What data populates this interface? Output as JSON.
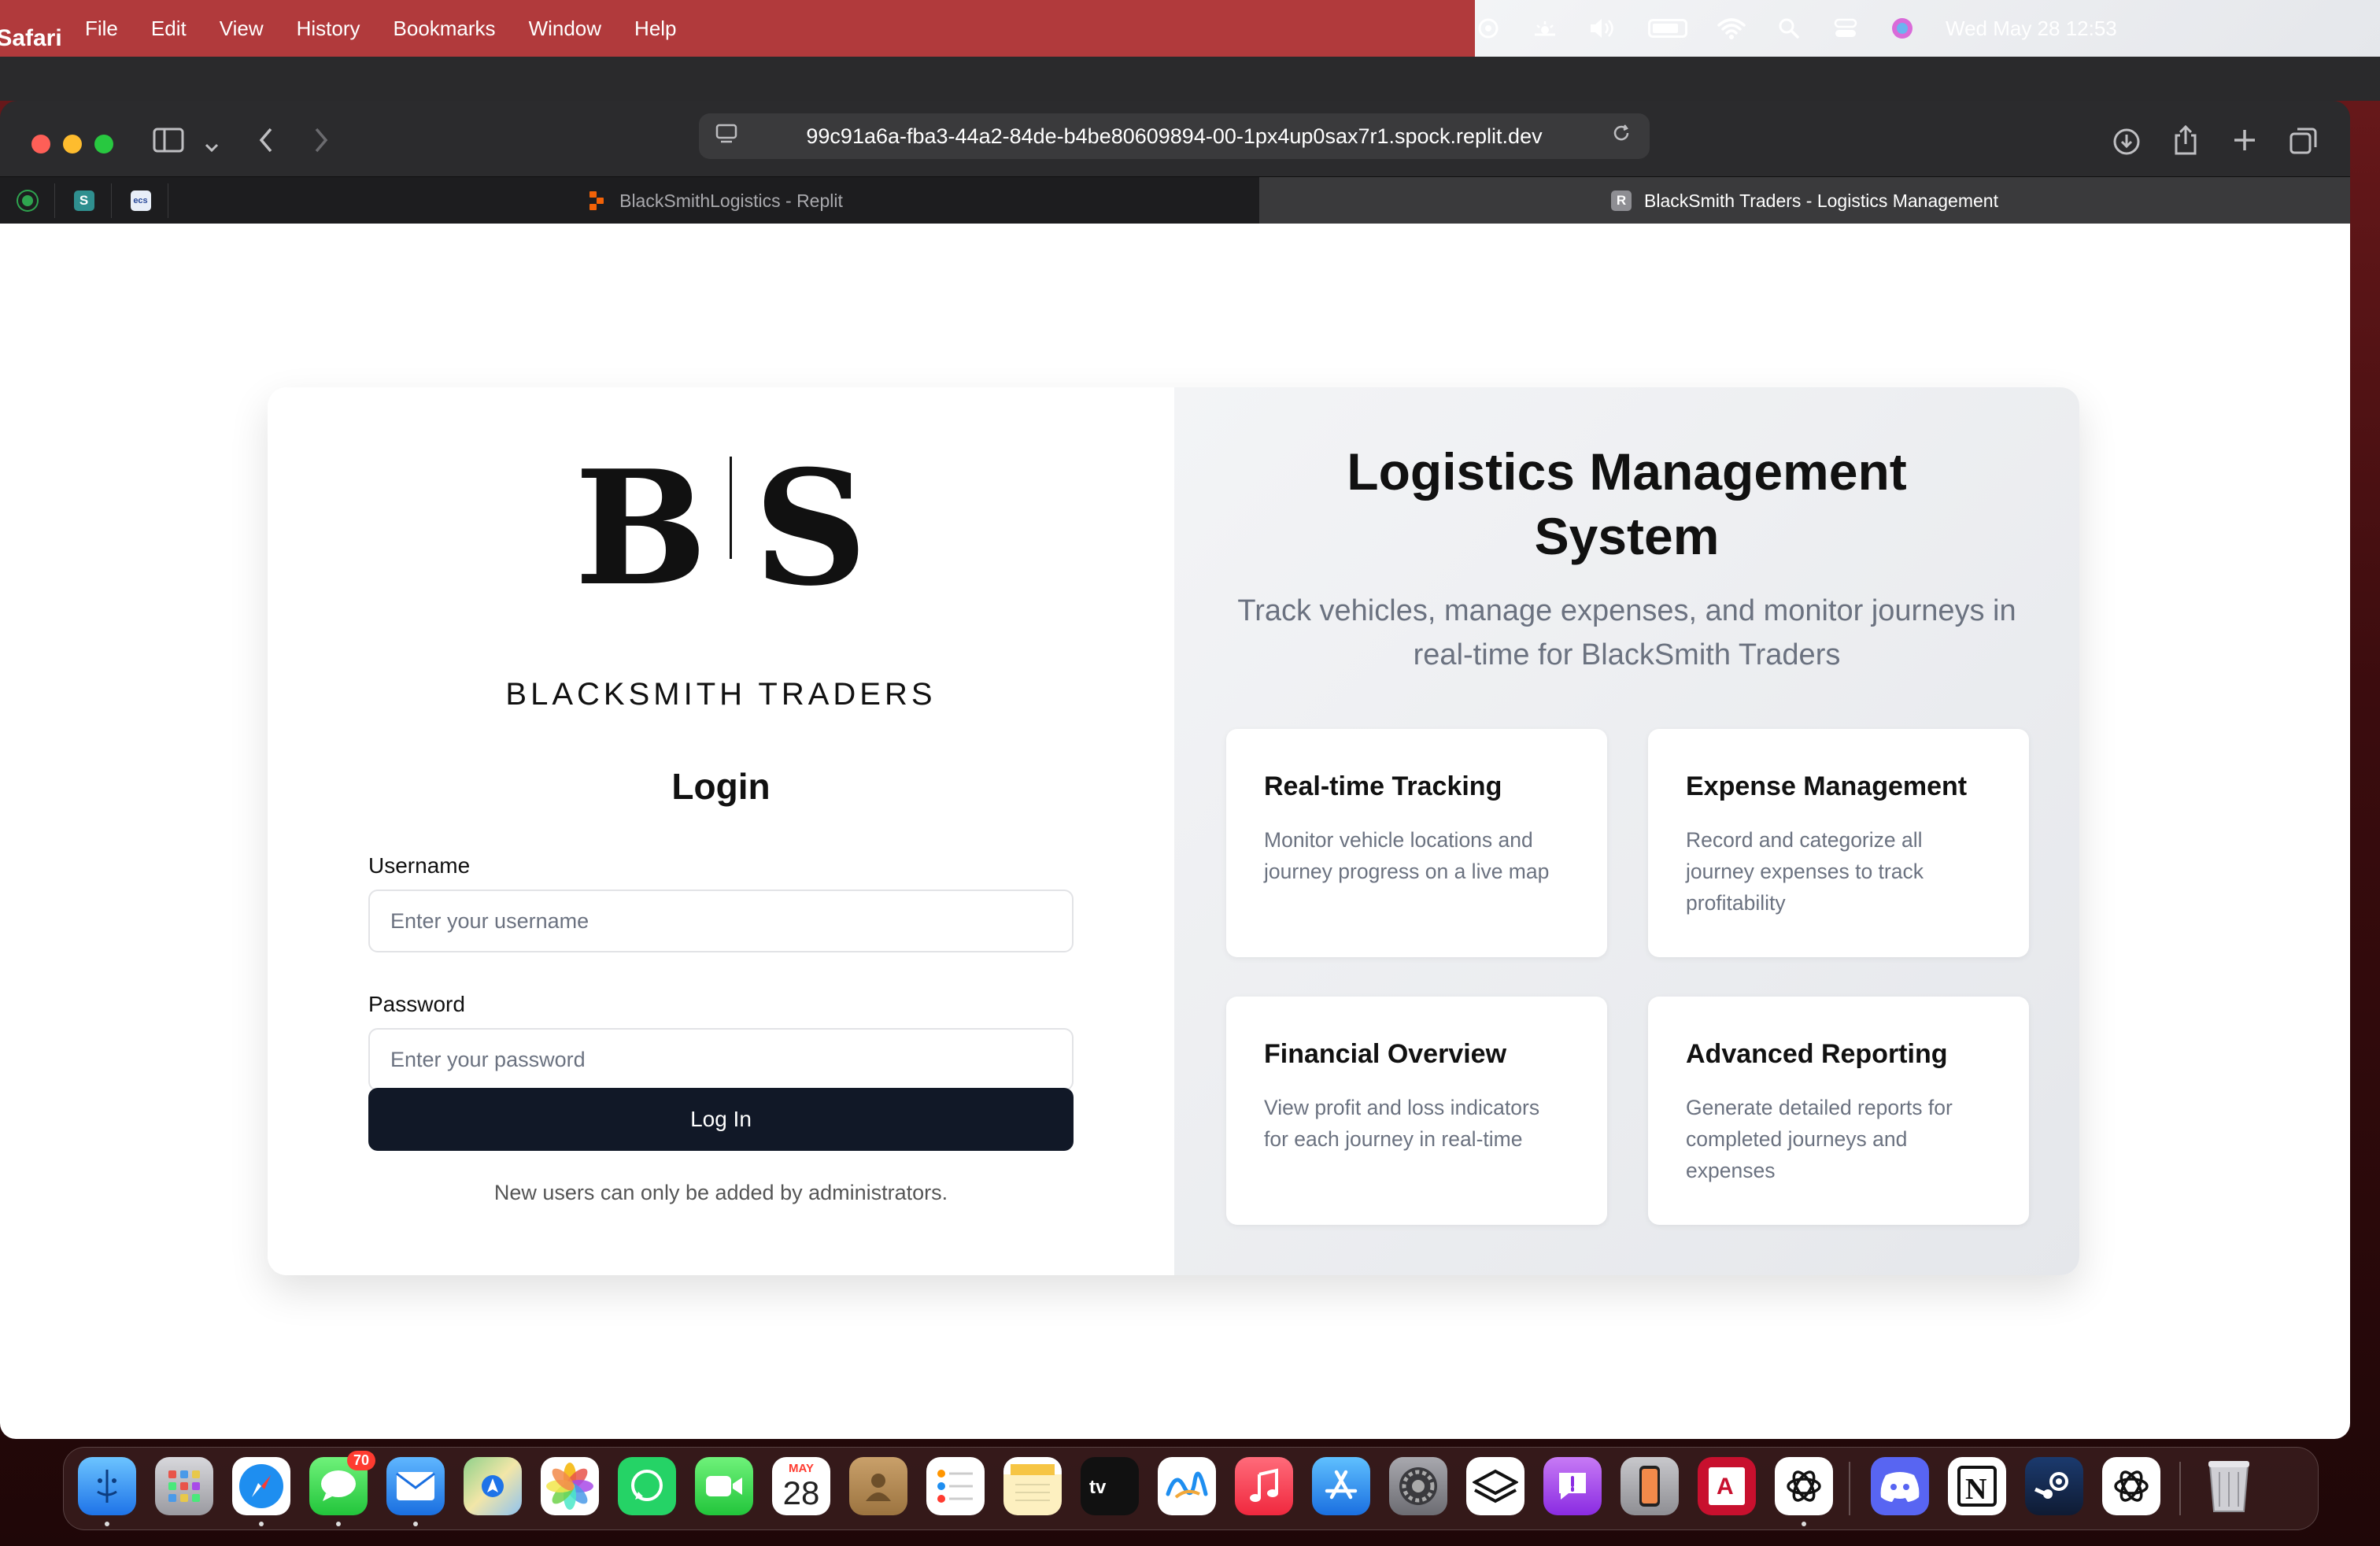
{
  "menubar": {
    "app_name": "Safari",
    "items": [
      "File",
      "Edit",
      "View",
      "History",
      "Bookmarks",
      "Window",
      "Help"
    ],
    "clock": "Wed May 28  12:53",
    "battery_level": 0.85
  },
  "browser": {
    "url": "99c91a6a-fba3-44a2-84de-b4be80609894-00-1px4up0sax7r1.spock.replit.dev",
    "tabs": [
      {
        "label": "BlackSmithLogistics - Replit",
        "favicon": "replit-icon",
        "active": false
      },
      {
        "label": "BlackSmith Traders - Logistics Management",
        "favicon": "R",
        "active": true
      }
    ],
    "pinned_tabs": [
      "green-circle-icon",
      "S",
      "ecs-icon"
    ]
  },
  "login": {
    "logo_left": "B",
    "logo_right": "S",
    "brand": "BLACKSMITH TRADERS",
    "title": "Login",
    "username_label": "Username",
    "username_placeholder": "Enter your username",
    "username_value": "",
    "password_label": "Password",
    "password_placeholder": "Enter your password",
    "password_value": "",
    "submit_label": "Log In",
    "note": "New users can only be added by administrators."
  },
  "hero": {
    "title": "Logistics Management System",
    "subtitle": "Track vehicles, manage expenses, and monitor journeys in real-time for BlackSmith Traders",
    "features": [
      {
        "title": "Real-time Tracking",
        "text": "Monitor vehicle locations and journey progress on a live map"
      },
      {
        "title": "Expense Management",
        "text": "Record and categorize all journey expenses to track profitability"
      },
      {
        "title": "Financial Overview",
        "text": "View profit and loss indicators for each journey in real-time"
      },
      {
        "title": "Advanced Reporting",
        "text": "Generate detailed reports for completed journeys and expenses"
      }
    ]
  },
  "dock": {
    "messages_badge": "70",
    "calendar_month": "MAY",
    "calendar_day": "28",
    "apps": [
      "finder-icon",
      "launchpad-icon",
      "safari-icon",
      "messages-icon",
      "mail-icon",
      "maps-icon",
      "photos-icon",
      "whatsapp-icon",
      "facetime-icon",
      "calendar-icon",
      "contacts-icon",
      "reminders-icon",
      "notes-icon",
      "appletv-icon",
      "freeform-icon",
      "music-icon",
      "appstore-icon",
      "settings-icon",
      "vectorworks-icon",
      "feedback-icon",
      "iphone-mirroring-icon",
      "autocad-icon",
      "chatgpt-icon",
      "discord-icon",
      "notion-icon",
      "steam-icon",
      "chatgpt-alt-icon",
      "trash-icon"
    ],
    "colors": {
      "accent": "#111827",
      "menubar": "#b13a3c"
    }
  }
}
